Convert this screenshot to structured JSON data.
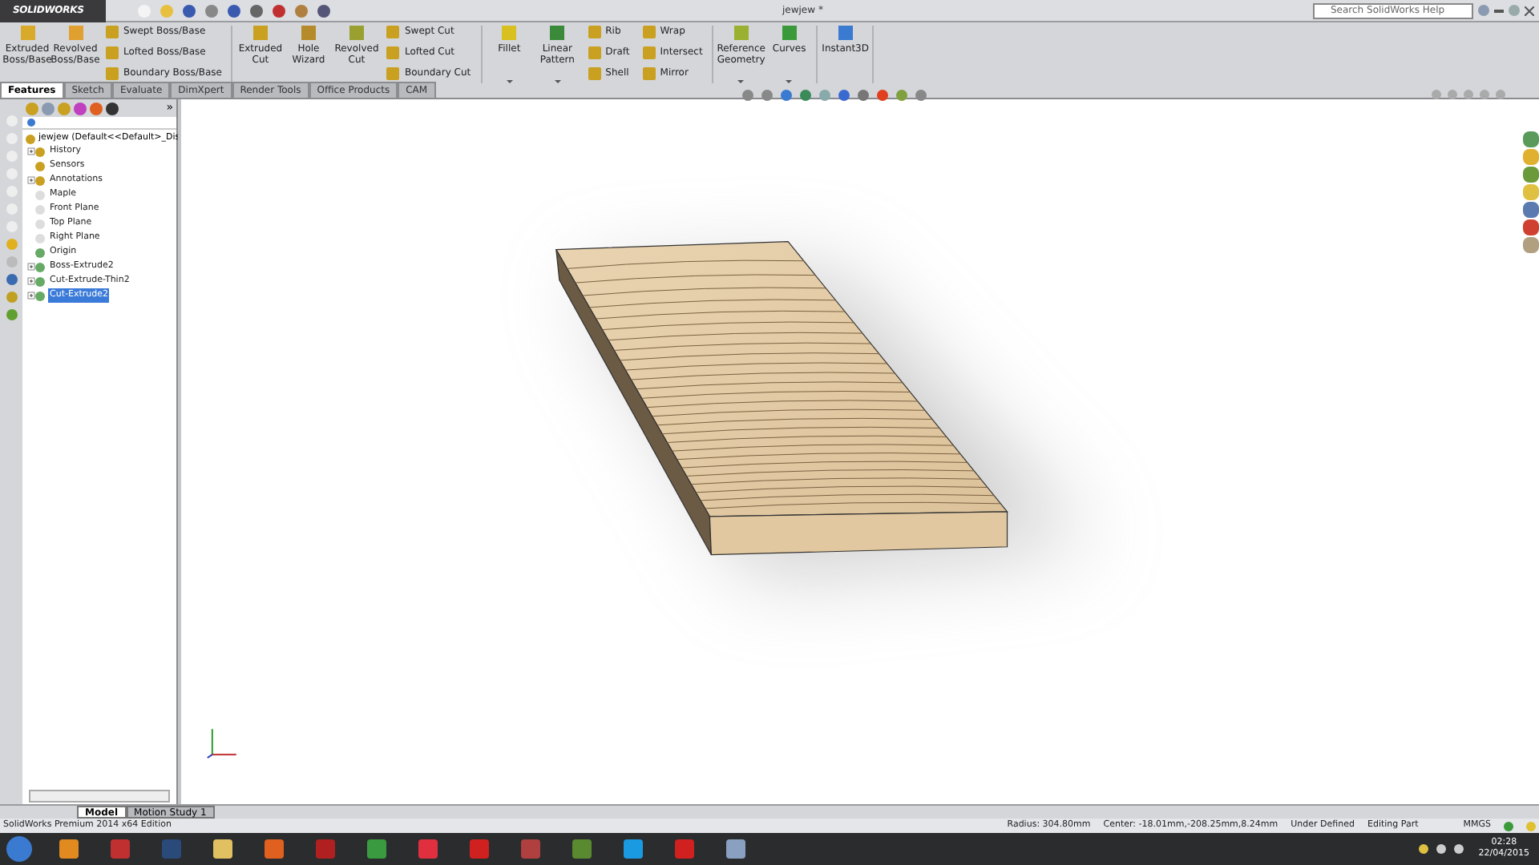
{
  "window": {
    "logo": "SOLIDWORKS",
    "title": "jewjew *",
    "search": {
      "placeholder": "Search SolidWorks Help"
    }
  },
  "ribbon": [
    {
      "items": [
        {
          "kind": "large",
          "label": "Extruded Boss/Base",
          "menu": false,
          "color": "#d9a92a"
        },
        {
          "kind": "large",
          "label": "Revolved Boss/Base",
          "menu": false,
          "color": "#e0a030"
        },
        {
          "kind": "stack",
          "entries": [
            "Swept Boss/Base",
            "Lofted Boss/Base",
            "Boundary Boss/Base"
          ]
        }
      ]
    },
    {
      "items": [
        {
          "kind": "large",
          "label": "Extruded Cut",
          "menu": false,
          "color": "#c9a020"
        },
        {
          "kind": "large",
          "label": "Hole Wizard",
          "menu": false,
          "color": "#b58a2a"
        },
        {
          "kind": "large",
          "label": "Revolved Cut",
          "menu": false,
          "color": "#9aa030"
        },
        {
          "kind": "stack",
          "entries": [
            "Swept Cut",
            "Lofted Cut",
            "Boundary Cut"
          ]
        }
      ]
    },
    {
      "items": [
        {
          "kind": "large",
          "label": "Fillet",
          "menu": true,
          "color": "#d8c020"
        },
        {
          "kind": "large",
          "label": "Linear Pattern",
          "menu": true,
          "color": "#3a8a3a"
        },
        {
          "kind": "stack",
          "entries": [
            "Rib",
            "Draft",
            "Shell"
          ]
        },
        {
          "kind": "stack",
          "entries": [
            "Wrap",
            "Intersect",
            "Mirror"
          ]
        }
      ]
    },
    {
      "items": [
        {
          "kind": "large",
          "label": "Reference Geometry",
          "menu": true,
          "color": "#9ab030"
        },
        {
          "kind": "large",
          "label": "Curves",
          "menu": true,
          "color": "#3a9a3a"
        }
      ]
    },
    {
      "items": [
        {
          "kind": "large",
          "label": "Instant3D",
          "menu": false,
          "color": "#3a7ad0"
        }
      ]
    }
  ],
  "tabs": [
    {
      "label": "Features",
      "selected": true
    },
    {
      "label": "Sketch",
      "selected": false
    },
    {
      "label": "Evaluate",
      "selected": false
    },
    {
      "label": "DimXpert",
      "selected": false
    },
    {
      "label": "Render Tools",
      "selected": false
    },
    {
      "label": "Office Products",
      "selected": false
    },
    {
      "label": "CAM",
      "selected": false
    }
  ],
  "feature_manager": {
    "more": "»",
    "tree": {
      "label": "jewjew  (Default<<Default>_Dis",
      "children": [
        {
          "label": "History",
          "expandable": true,
          "selected": false
        },
        {
          "label": "Sensors",
          "expandable": false,
          "selected": false
        },
        {
          "label": "Annotations",
          "expandable": true,
          "selected": false
        },
        {
          "label": "Maple",
          "expandable": false,
          "selected": false
        },
        {
          "label": "Front Plane",
          "expandable": false,
          "selected": false
        },
        {
          "label": "Top Plane",
          "expandable": false,
          "selected": false
        },
        {
          "label": "Right Plane",
          "expandable": false,
          "selected": false
        },
        {
          "label": "Origin",
          "expandable": false,
          "selected": false
        },
        {
          "label": "Boss-Extrude2",
          "expandable": true,
          "selected": false
        },
        {
          "label": "Cut-Extrude-Thin2",
          "expandable": true,
          "selected": false
        },
        {
          "label": "Cut-Extrude2",
          "expandable": true,
          "selected": true
        }
      ]
    }
  },
  "bottom_tabs": [
    {
      "label": "Model",
      "selected": true
    },
    {
      "label": "Motion Study 1",
      "selected": false
    }
  ],
  "status_bar": {
    "edition": "SolidWorks Premium 2014 x64 Edition",
    "radius": "Radius: 304.80mm",
    "center": "Center: -18.01mm,-208.25mm,8.24mm",
    "state": "Under Defined",
    "mode": "Editing Part",
    "units": "MMGS"
  },
  "taskbar": {
    "apps": [
      {
        "color": "#e08a20"
      },
      {
        "color": "#c03030"
      },
      {
        "color": "#2a4a7a"
      },
      {
        "color": "#e0c060"
      },
      {
        "color": "#e06020"
      },
      {
        "color": "#b02020"
      },
      {
        "color": "#3a9a40"
      },
      {
        "color": "#e03040"
      },
      {
        "color": "#d02020"
      },
      {
        "color": "#b04040"
      },
      {
        "color": "#5a8a30"
      },
      {
        "color": "#1a9ae0"
      },
      {
        "color": "#d02020"
      },
      {
        "color": "#8aa0c0"
      }
    ],
    "time": "02:28",
    "date": "22/04/2015"
  }
}
